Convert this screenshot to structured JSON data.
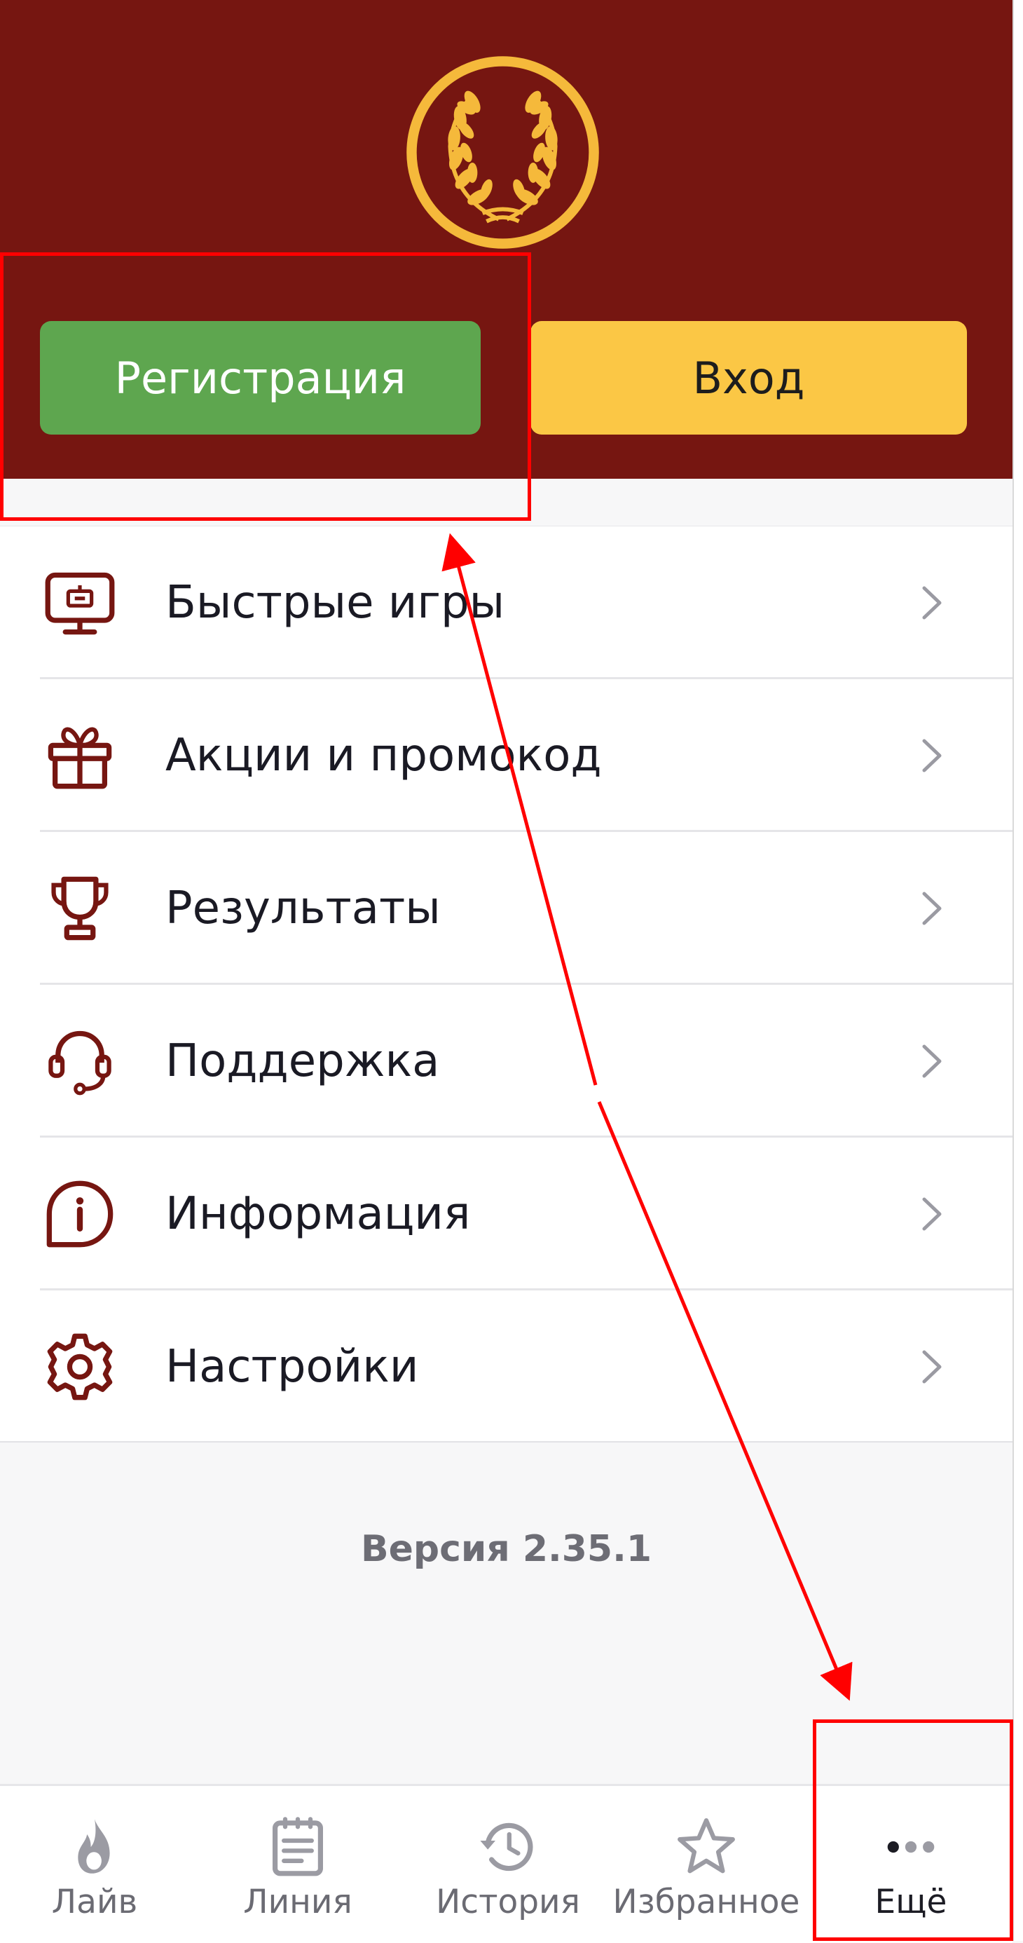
{
  "colors": {
    "header_bg": "#761611",
    "register_bg": "#5ea64f",
    "login_bg": "#fbc745",
    "logo_gold": "#f5b93b",
    "icon_maroon": "#761611",
    "annotation_red": "#ff0000"
  },
  "header": {
    "logo_icon": "laurel-wreath-logo",
    "register_label": "Регистрация",
    "login_label": "Вход"
  },
  "menu": {
    "items": [
      {
        "label": "Быстрые игры",
        "icon": "monitor-game-icon"
      },
      {
        "label": "Акции и промокод",
        "icon": "gift-icon"
      },
      {
        "label": "Результаты",
        "icon": "trophy-icon"
      },
      {
        "label": "Поддержка",
        "icon": "headset-icon"
      },
      {
        "label": "Информация",
        "icon": "info-bubble-icon"
      },
      {
        "label": "Настройки",
        "icon": "gear-icon"
      }
    ],
    "chevron_icon": "chevron-right-icon"
  },
  "version": "Версия 2.35.1",
  "bottom_nav": {
    "items": [
      {
        "label": "Лайв",
        "icon": "flame-icon",
        "active": false
      },
      {
        "label": "Линия",
        "icon": "document-icon",
        "active": false
      },
      {
        "label": "История",
        "icon": "history-icon",
        "active": false
      },
      {
        "label": "Избранное",
        "icon": "star-icon",
        "active": false
      },
      {
        "label": "Ещё",
        "icon": "more-dots-icon",
        "active": true
      }
    ]
  }
}
